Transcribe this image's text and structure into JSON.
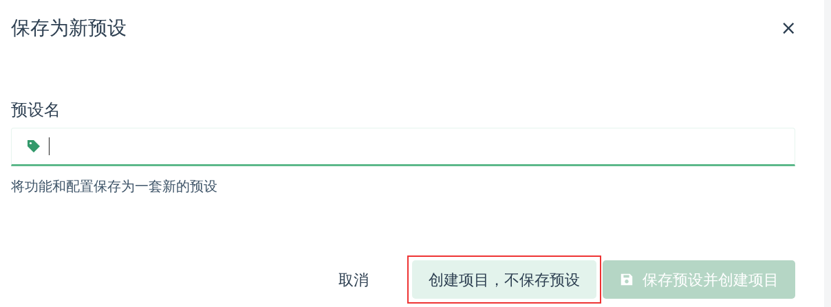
{
  "dialog": {
    "title": "保存为新预设",
    "close": "×"
  },
  "field": {
    "label": "预设名",
    "focused": true,
    "hint": "将功能和配置保存为一套新的预设"
  },
  "buttons": [
    {
      "kind": "text",
      "label": "取消",
      "highlighted": false,
      "disabled": false
    },
    {
      "kind": "soft",
      "label": "创建项目，不保存预设",
      "highlighted": true,
      "disabled": false
    },
    {
      "kind": "primary",
      "label": "保存预设并创建项目",
      "highlighted": false,
      "disabled": true
    }
  ]
}
